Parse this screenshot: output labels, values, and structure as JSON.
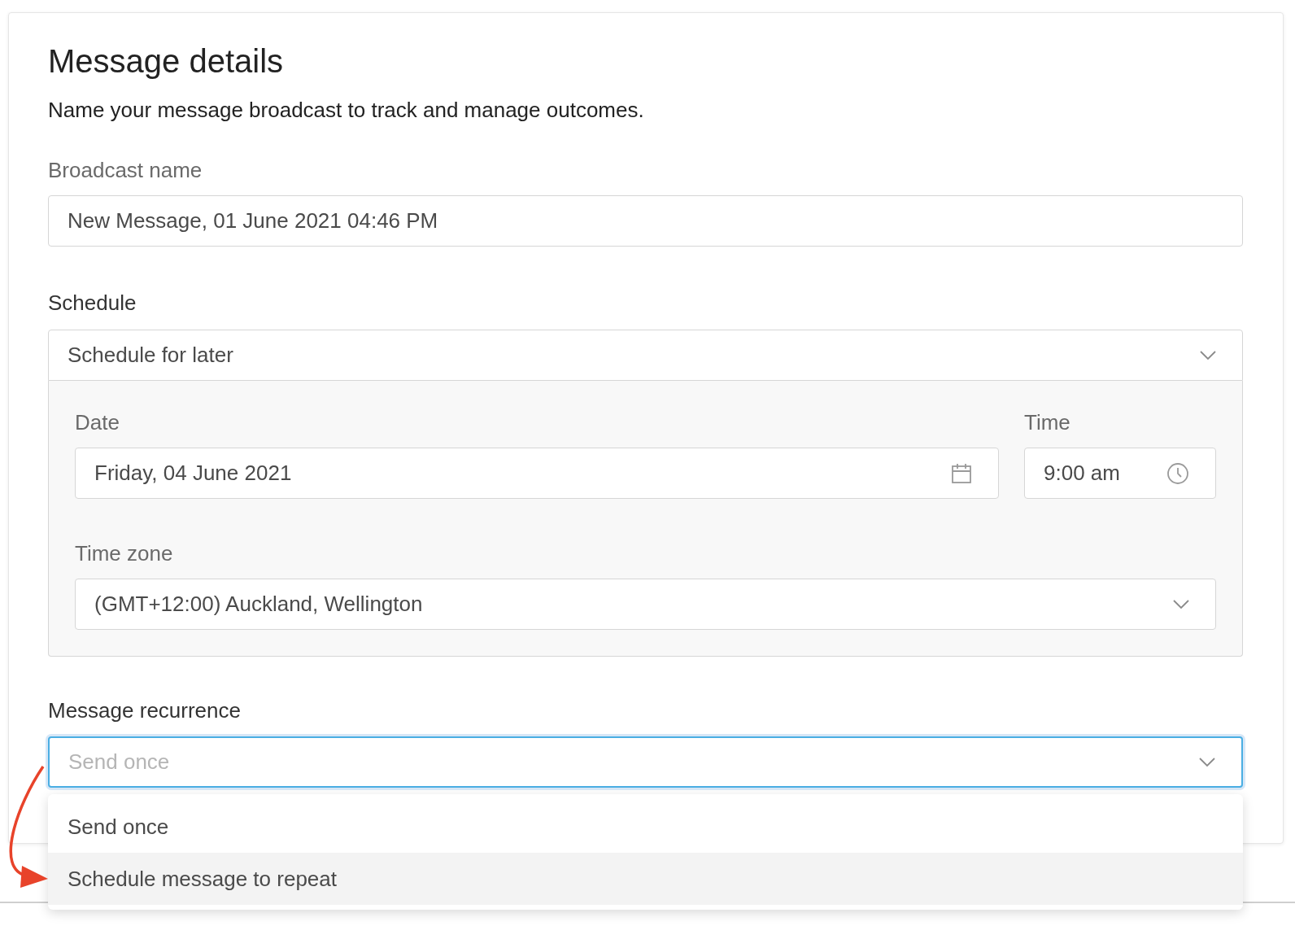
{
  "title": "Message details",
  "subtitle": "Name your message broadcast to track and manage outcomes.",
  "broadcast_name": {
    "label": "Broadcast name",
    "value": "New Message, 01 June 2021 04:46 PM"
  },
  "schedule": {
    "label": "Schedule",
    "value": "Schedule for later",
    "expanded": true,
    "date": {
      "label": "Date",
      "value": "Friday, 04 June 2021"
    },
    "time": {
      "label": "Time",
      "value": "9:00 am"
    },
    "time_zone": {
      "label": "Time zone",
      "value": "(GMT+12:00) Auckland, Wellington"
    }
  },
  "recurrence": {
    "label": "Message recurrence",
    "placeholder": "Send once",
    "focused": true,
    "expanded": true,
    "options": [
      {
        "label": "Send once",
        "highlighted": false
      },
      {
        "label": "Schedule message to repeat",
        "highlighted": true
      }
    ]
  },
  "annotation": {
    "kind": "arrow"
  }
}
